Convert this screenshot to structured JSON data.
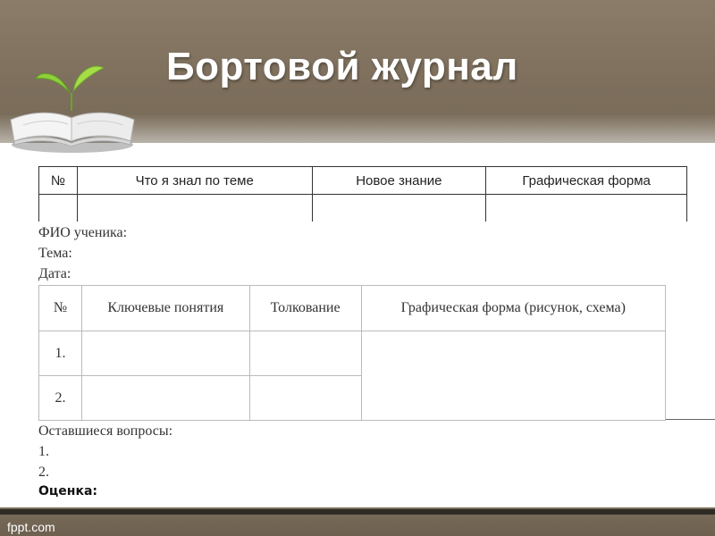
{
  "slide": {
    "title": "Бортовой журнал",
    "footer_brand": "fppt.com"
  },
  "top_table": {
    "headers": [
      "№",
      "Что я знал по теме",
      "Новое знание",
      "Графическая форма"
    ]
  },
  "sheet": {
    "student_label": "ФИО ученика:",
    "topic_label": "Тема:",
    "date_label": "Дата:",
    "table": {
      "headers": [
        "№",
        "Ключевые понятия",
        "Толкование",
        "Графическая форма (рисунок, схема)"
      ],
      "rows": [
        {
          "num": "1.",
          "concept": "",
          "interpretation": "",
          "graphic": ""
        },
        {
          "num": "2.",
          "concept": "",
          "interpretation": "",
          "graphic": ""
        }
      ]
    },
    "remaining_label": "Оставшиеся вопросы:",
    "remaining_items": [
      "1.",
      "2."
    ],
    "grade_label": "Оценка:"
  },
  "colors": {
    "header_band": "#7d6f5c",
    "title_text": "#ffffff",
    "footer_band": "#6d604f"
  },
  "icons": {
    "logo": "open-book-sprout-icon"
  }
}
